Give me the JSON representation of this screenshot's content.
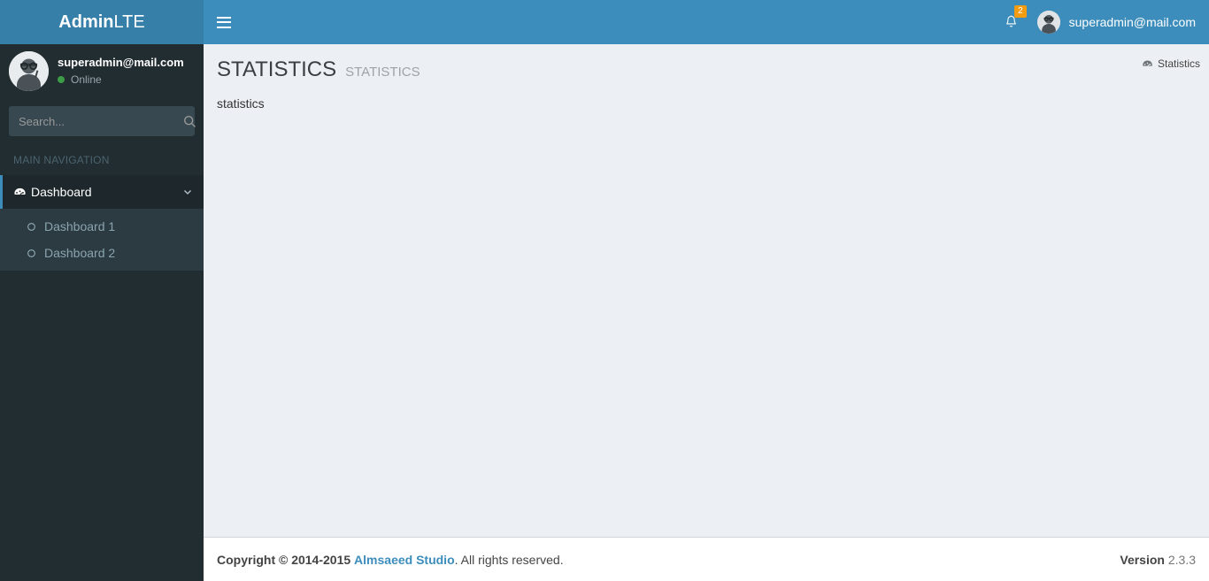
{
  "colors": {
    "header_blue": "#3c8dbc",
    "logo_blue": "#367fa9",
    "sidebar_dark": "#222d32",
    "sidebar_submenu": "#2c3b41",
    "content_bg": "#ecf0f5",
    "badge_orange": "#f39c12",
    "online_green": "#3c9c48",
    "link_blue": "#3c8dbc"
  },
  "logo": {
    "bold_part": "Admin",
    "light_part": "LTE"
  },
  "navbar": {
    "toggle_icon": "hamburger-icon",
    "notifications": {
      "icon": "bell-icon",
      "count": "2"
    },
    "user": {
      "avatar_icon": "user-avatar",
      "name": "superadmin@mail.com"
    }
  },
  "sidebar": {
    "user_panel": {
      "avatar_icon": "user-avatar",
      "name": "superadmin@mail.com",
      "status": "Online",
      "status_icon": "circle-online-icon"
    },
    "search": {
      "placeholder": "Search...",
      "button_icon": "search-icon"
    },
    "menu_header": "MAIN NAVIGATION",
    "items": [
      {
        "label": "Dashboard",
        "icon": "dashboard-icon",
        "arrow_icon": "chevron-down-icon",
        "active": true,
        "children": [
          {
            "label": "Dashboard 1",
            "icon": "circle-o-icon"
          },
          {
            "label": "Dashboard 2",
            "icon": "circle-o-icon"
          }
        ]
      }
    ]
  },
  "content": {
    "title": "STATISTICS",
    "subtitle": "STATISTICS",
    "breadcrumb": {
      "icon": "dashboard-icon",
      "text": "Statistics"
    },
    "body_text": "statistics"
  },
  "footer": {
    "copyright_prefix": "Copyright © 2014-2015",
    "studio_link": "Almsaeed Studio",
    "rights_text": ". All rights reserved.",
    "version_label": "Version",
    "version_number": "2.3.3"
  }
}
